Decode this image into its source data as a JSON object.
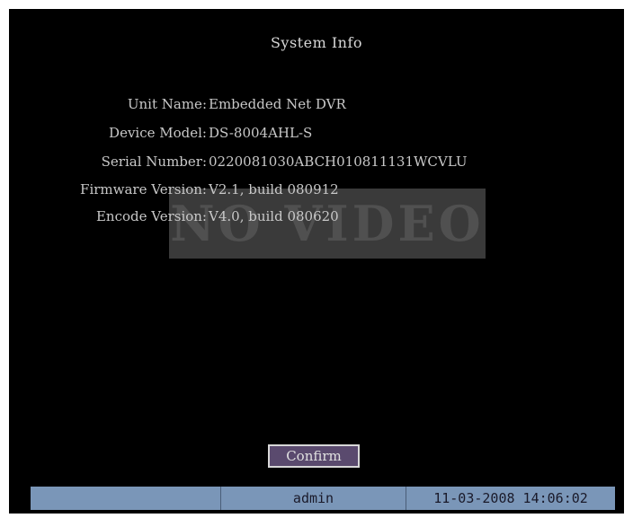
{
  "dialog": {
    "title": "System Info",
    "fields": [
      {
        "label": "Unit Name:",
        "value": "Embedded Net DVR"
      },
      {
        "label": "Device Model:",
        "value": "DS-8004AHL-S"
      },
      {
        "label": "Serial Number:",
        "value": "0220081030ABCH010811131WCVLU"
      },
      {
        "label": "Firmware Version:",
        "value": "V2.1, build 080912"
      },
      {
        "label": "Encode Version:",
        "value": "V4.0, build 080620"
      }
    ],
    "confirm_label": "Confirm"
  },
  "overlay": {
    "no_video_text": "NO VIDEO"
  },
  "status_bar": {
    "left": "",
    "user": "admin",
    "datetime": "11-03-2008 14:06:02"
  },
  "colors": {
    "background": "#000000",
    "status_bar": "#7a96b8",
    "button_bg": "#5a4a6e"
  }
}
